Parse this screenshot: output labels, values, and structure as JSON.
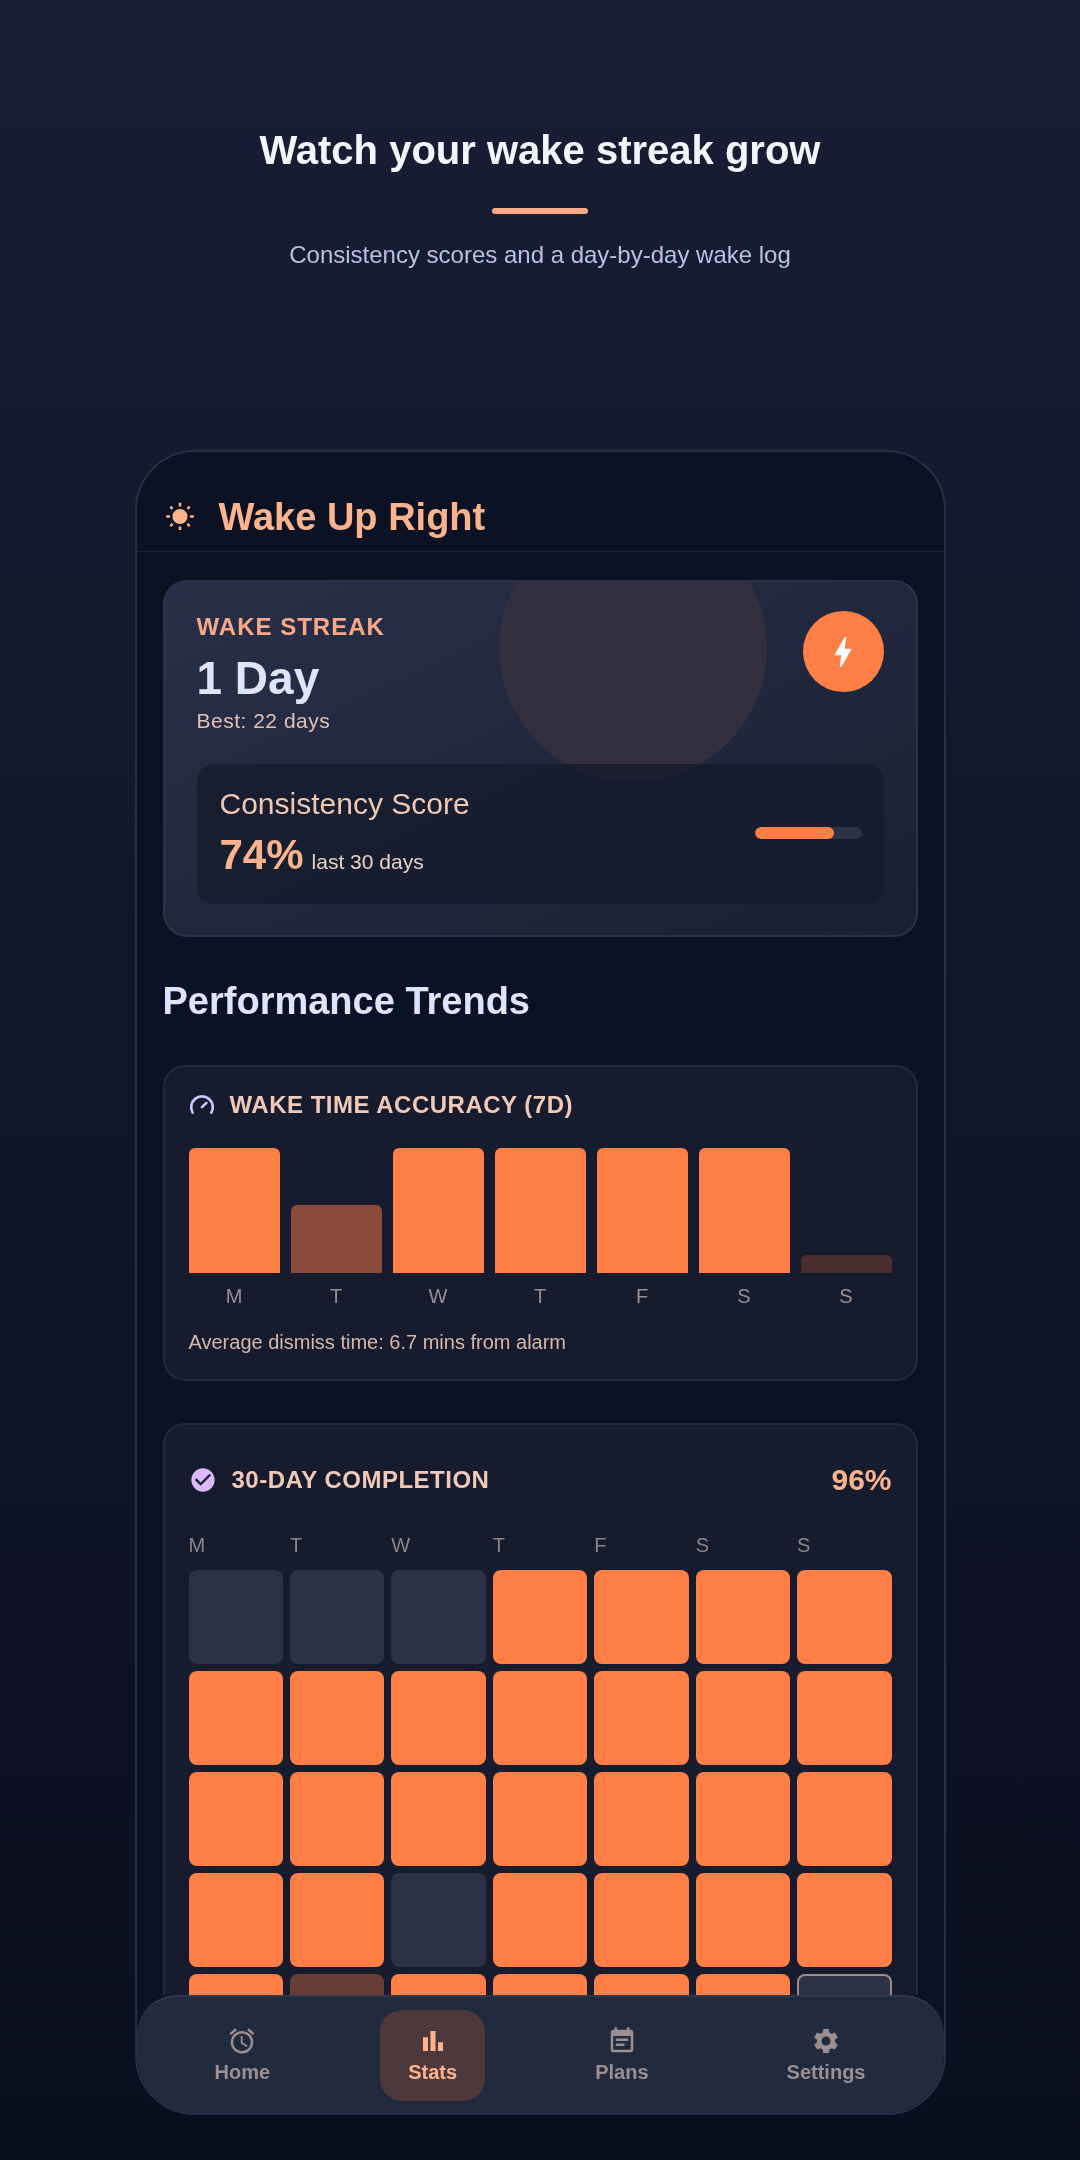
{
  "intro": {
    "title": "Watch your wake streak grow",
    "subtitle": "Consistency scores and a day-by-day wake log"
  },
  "app_bar": {
    "title": "Wake Up Right"
  },
  "streak_card": {
    "label": "WAKE STREAK",
    "value": "1 Day",
    "best": "Best: 22 days",
    "consistency": {
      "title": "Consistency Score",
      "value": "74%",
      "period": "last 30 days",
      "level": 0.74
    }
  },
  "section_title": "Performance Trends",
  "accuracy_card": {
    "title": "WAKE TIME ACCURACY (7D)",
    "days": [
      {
        "label": "M",
        "color": "#ff7f47"
      },
      {
        "label": "T",
        "color": "#8b4b3a"
      },
      {
        "label": "W",
        "color": "#ff7f47"
      },
      {
        "label": "T",
        "color": "#ff7f47"
      },
      {
        "label": "F",
        "color": "#ff7f47"
      },
      {
        "label": "S",
        "color": "#ff7f47"
      },
      {
        "label": "S",
        "color": "#4a2d2f"
      }
    ],
    "note": "Average dismiss time: 6.7 mins from alarm"
  },
  "completion_card": {
    "title": "30-DAY COMPLETION",
    "percent": "96%",
    "weekdays": [
      "M",
      "T",
      "W",
      "T",
      "F",
      "S",
      "S"
    ],
    "weeks": [
      [
        {
          "kind": "missed"
        },
        {
          "kind": "missed"
        },
        {
          "kind": "missed"
        },
        {
          "kind": "done"
        },
        {
          "kind": "done"
        },
        {
          "kind": "done"
        },
        {
          "kind": "done"
        }
      ],
      [
        {
          "kind": "done"
        },
        {
          "kind": "done"
        },
        {
          "kind": "done"
        },
        {
          "kind": "done"
        },
        {
          "kind": "done"
        },
        {
          "kind": "done"
        },
        {
          "kind": "done"
        }
      ],
      [
        {
          "kind": "done"
        },
        {
          "kind": "done"
        },
        {
          "kind": "done"
        },
        {
          "kind": "done"
        },
        {
          "kind": "done"
        },
        {
          "kind": "done"
        },
        {
          "kind": "done"
        }
      ],
      [
        {
          "kind": "done"
        },
        {
          "kind": "done"
        },
        {
          "kind": "missed"
        },
        {
          "kind": "done"
        },
        {
          "kind": "done"
        },
        {
          "kind": "done"
        },
        {
          "kind": "done"
        }
      ],
      [
        {
          "kind": "done"
        },
        {
          "kind": "partial"
        },
        {
          "kind": "done"
        },
        {
          "kind": "done"
        },
        {
          "kind": "done"
        },
        {
          "kind": "done"
        },
        {
          "kind": "today"
        }
      ]
    ]
  },
  "nav": [
    {
      "label": "Home",
      "selected": false
    },
    {
      "label": "Stats",
      "selected": true
    },
    {
      "label": "Plans",
      "selected": false
    },
    {
      "label": "Settings",
      "selected": false
    }
  ]
}
